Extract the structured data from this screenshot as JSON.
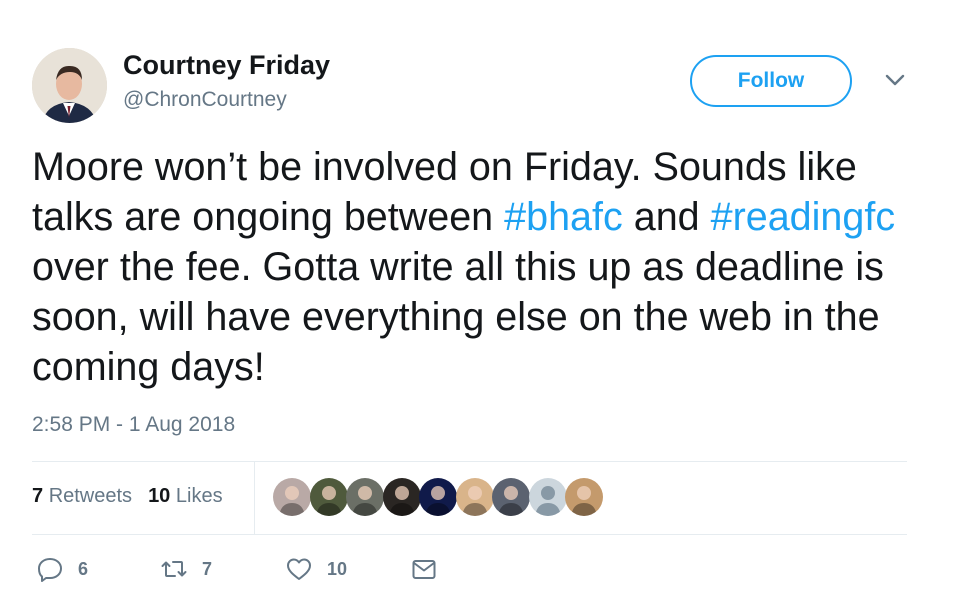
{
  "author": {
    "name": "Courtney Friday",
    "handle": "@ChronCourtney"
  },
  "follow_label": "Follow",
  "tweet": {
    "parts": [
      {
        "text": "Moore won’t be involved on Friday. Sounds like talks are ongoing between ",
        "type": "text"
      },
      {
        "text": "#bhafc",
        "type": "hashtag"
      },
      {
        "text": " and ",
        "type": "text"
      },
      {
        "text": "#readingfc",
        "type": "hashtag"
      },
      {
        "text": " over the fee. Gotta write all this up as deadline is soon, will have everything else on the web in the coming days!",
        "type": "text"
      }
    ]
  },
  "timestamp": "2:58 PM - 1 Aug 2018",
  "stats": {
    "retweets_count": "7",
    "retweets_label": "Retweets",
    "likes_count": "10",
    "likes_label": "Likes"
  },
  "likers": [
    {
      "icon": "liker-avatar",
      "color": "#b9a9a6"
    },
    {
      "icon": "liker-avatar",
      "color": "#4f5a3c"
    },
    {
      "icon": "liker-avatar",
      "color": "#6b6f66"
    },
    {
      "icon": "liker-avatar",
      "color": "#2a2623"
    },
    {
      "icon": "liker-avatar",
      "color": "#101a4a"
    },
    {
      "icon": "liker-avatar",
      "color": "#d9b48a"
    },
    {
      "icon": "liker-avatar",
      "color": "#5b6270"
    },
    {
      "icon": "default-avatar",
      "color": "#ccd6dd"
    },
    {
      "icon": "liker-avatar",
      "color": "#c49a6c"
    }
  ],
  "actions": {
    "reply_count": "6",
    "retweet_count": "7",
    "like_count": "10"
  },
  "colors": {
    "accent": "#1da1f2",
    "muted": "#657786",
    "text": "#14171a"
  }
}
